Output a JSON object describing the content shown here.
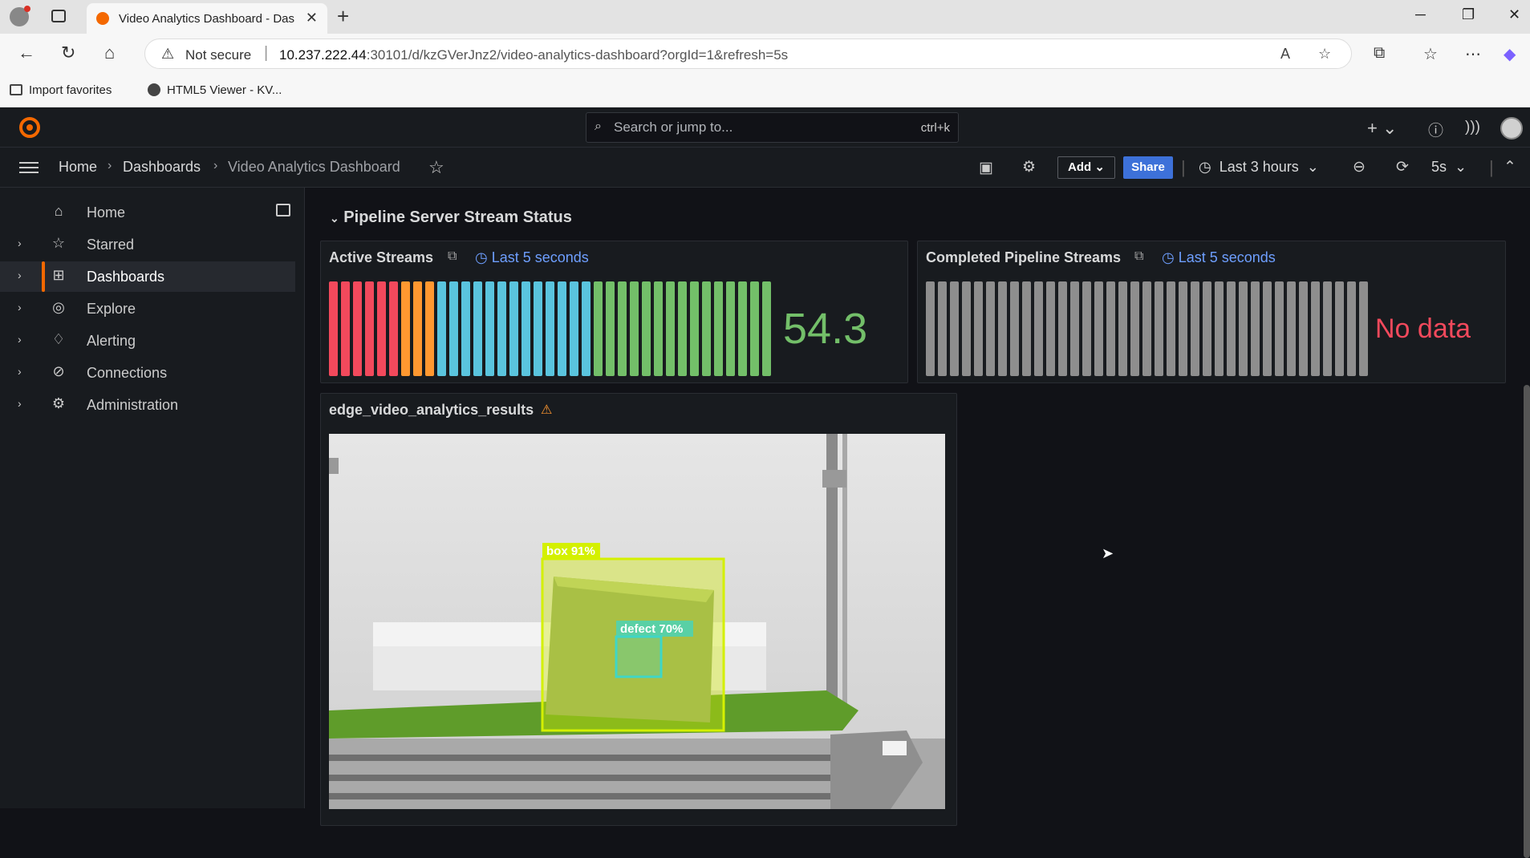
{
  "browser": {
    "tab_title": "Video Analytics Dashboard - Dashboards",
    "security_label": "Not secure",
    "url_host": "10.237.222.44",
    "url_rest": ":30101/d/kzGVerJnz2/video-analytics-dashboard?orgId=1&refresh=5s",
    "bookmarks": [
      {
        "label": "Import favorites"
      },
      {
        "label": "HTML5 Viewer - KV..."
      }
    ]
  },
  "grafana": {
    "search_placeholder": "Search or jump to...",
    "search_shortcut": "ctrl+k",
    "breadcrumbs": [
      "Home",
      "Dashboards",
      "Video Analytics Dashboard"
    ],
    "add_label": "Add",
    "share_label": "Share",
    "time_range": "Last 3 hours",
    "refresh_interval": "5s",
    "sidebar": [
      {
        "label": "Home",
        "icon": "home-icon",
        "active": false
      },
      {
        "label": "Starred",
        "icon": "star-icon",
        "active": false
      },
      {
        "label": "Dashboards",
        "icon": "grid-icon",
        "active": true
      },
      {
        "label": "Explore",
        "icon": "compass-icon",
        "active": false
      },
      {
        "label": "Alerting",
        "icon": "bell-icon",
        "active": false
      },
      {
        "label": "Connections",
        "icon": "connections-icon",
        "active": false
      },
      {
        "label": "Administration",
        "icon": "gear-icon",
        "active": false
      }
    ]
  },
  "dashboard": {
    "row_title": "Pipeline Server Stream Status",
    "panels": {
      "active": {
        "title": "Active Streams",
        "time": "Last 5 seconds",
        "value": "54.3",
        "bar_colors": [
          "#f2495c",
          "#f2495c",
          "#f2495c",
          "#f2495c",
          "#f2495c",
          "#f2495c",
          "#ff9830",
          "#ff9830",
          "#ff9830",
          "#5ac4de",
          "#5ac4de",
          "#5ac4de",
          "#5ac4de",
          "#5ac4de",
          "#5ac4de",
          "#5ac4de",
          "#5ac4de",
          "#5ac4de",
          "#5ac4de",
          "#5ac4de",
          "#5ac4de",
          "#5ac4de",
          "#73bf69",
          "#73bf69",
          "#73bf69",
          "#73bf69",
          "#73bf69",
          "#73bf69",
          "#73bf69",
          "#73bf69",
          "#73bf69",
          "#73bf69",
          "#73bf69",
          "#73bf69",
          "#73bf69",
          "#73bf69",
          "#73bf69"
        ]
      },
      "completed": {
        "title": "Completed Pipeline Streams",
        "time": "Last 5 seconds",
        "value": "No data",
        "bar_count": 37,
        "bar_color": "#8e8e8e"
      },
      "video": {
        "title": "edge_video_analytics_results",
        "detections": [
          {
            "label": "box 91%",
            "color": "#d4f000"
          },
          {
            "label": "defect 70%",
            "color": "#3fd6c6"
          }
        ]
      }
    }
  },
  "colors": {
    "accent": "#f46800",
    "link": "#6e9fff",
    "share": "#3d71d9",
    "ok": "#73bf69",
    "error": "#f2495c",
    "warning": "#ff9830"
  }
}
